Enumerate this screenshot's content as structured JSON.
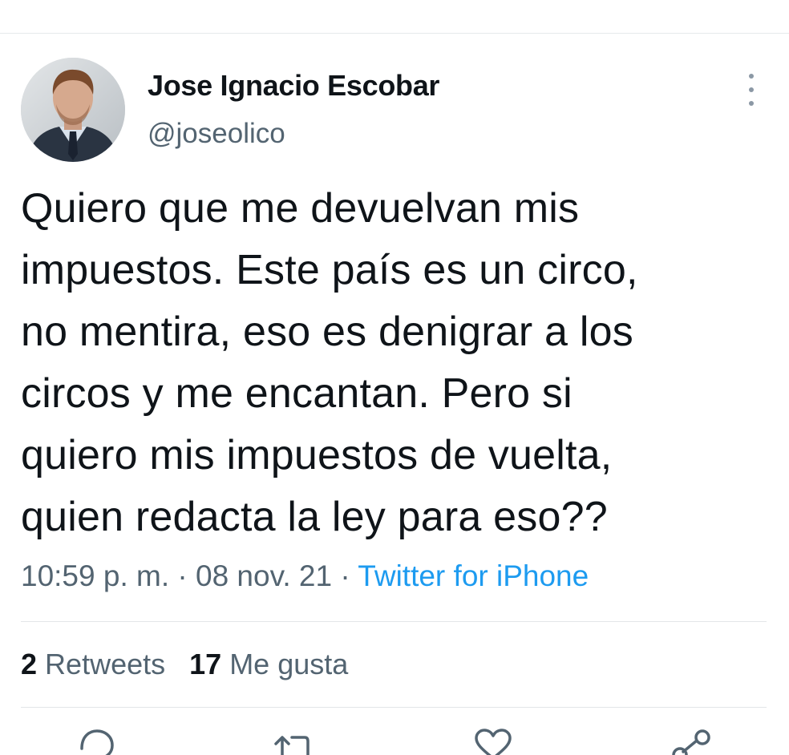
{
  "tweet": {
    "author_name": "Jose Ignacio Escobar",
    "author_handle": "@joseolico",
    "text_lines": [
      "Quiero que me devuelvan mis",
      "impuestos. Este país es un circo,",
      "no mentira, eso es denigrar a los",
      "circos y me encantan. Pero si",
      "quiero mis impuestos de vuelta,",
      "quien redacta la ley para eso??"
    ],
    "time": "10:59 p. m.",
    "date": "08 nov. 21",
    "separator": "·",
    "source": "Twitter for iPhone"
  },
  "stats": {
    "retweets_count": "2",
    "retweets_label": "Retweets",
    "likes_count": "17",
    "likes_label": "Me gusta"
  },
  "icons": {
    "more": "more-vertical-icon",
    "reply": "reply-icon",
    "retweet": "retweet-icon",
    "like": "heart-icon",
    "share": "share-icon"
  },
  "colors": {
    "text": "#0f1419",
    "secondary": "#536471",
    "link": "#1d9bf0",
    "divider": "#e3e6e8"
  }
}
